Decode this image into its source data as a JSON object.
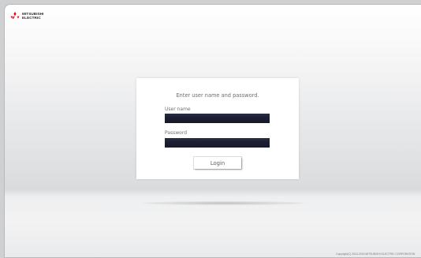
{
  "brand": {
    "line1": "MITSUBISHI",
    "line2": "ELECTRIC",
    "logo_icon": "three-diamond-logo-icon",
    "logo_color": "#e60012"
  },
  "login": {
    "instruction": "Enter user name and password.",
    "username_label": "User name",
    "username_value": "",
    "password_label": "Password",
    "password_value": "",
    "login_label": "Login"
  },
  "footer": {
    "copyright": "Copyright(C) 2015-2019 MITSUBISHI ELECTRIC CORPORATION"
  }
}
